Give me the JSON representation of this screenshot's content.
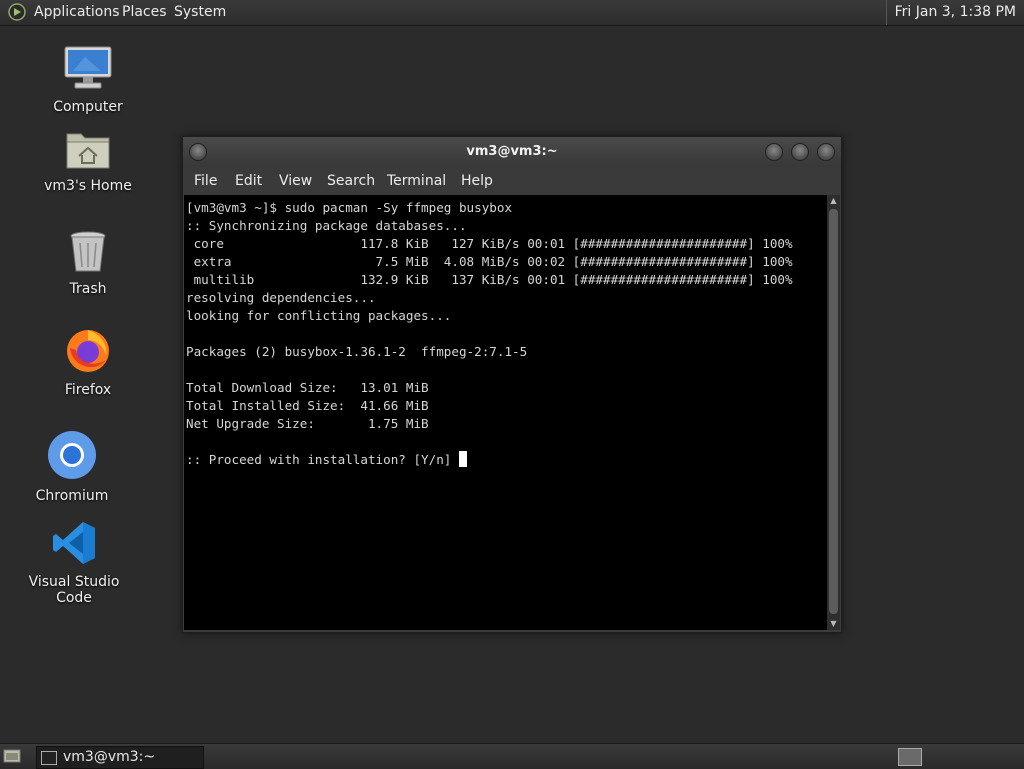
{
  "top_panel": {
    "menus": [
      "Applications",
      "Places",
      "System"
    ],
    "clock": "Fri Jan  3,  1:38 PM"
  },
  "desktop": {
    "icons": [
      {
        "label": "Computer",
        "icon": "computer-icon"
      },
      {
        "label": "vm3's Home",
        "icon": "home-folder-icon"
      },
      {
        "label": "Trash",
        "icon": "trash-icon"
      },
      {
        "label": "Firefox",
        "icon": "firefox-icon"
      },
      {
        "label": "Chromium",
        "icon": "chromium-icon"
      },
      {
        "label": "Visual Studio Code",
        "icon": "vscode-icon"
      }
    ]
  },
  "terminal": {
    "title": "vm3@vm3:~",
    "menu": [
      "File",
      "Edit",
      "View",
      "Search",
      "Terminal",
      "Help"
    ],
    "output": "[vm3@vm3 ~]$ sudo pacman -Sy ffmpeg busybox\n:: Synchronizing package databases...\n core                  117.8 KiB   127 KiB/s 00:01 [######################] 100%\n extra                   7.5 MiB  4.08 MiB/s 00:02 [######################] 100%\n multilib              132.9 KiB   137 KiB/s 00:01 [######################] 100%\nresolving dependencies...\nlooking for conflicting packages...\n\nPackages (2) busybox-1.36.1-2  ffmpeg-2:7.1-5\n\nTotal Download Size:   13.01 MiB\nTotal Installed Size:  41.66 MiB\nNet Upgrade Size:       1.75 MiB\n\n:: Proceed with installation? [Y/n] "
  },
  "bottom_panel": {
    "task_label": "vm3@vm3:~"
  },
  "colors": {
    "desktop_bg": "#2b2b2b",
    "terminal_bg": "#000000",
    "terminal_fg": "#d6d6d6"
  }
}
